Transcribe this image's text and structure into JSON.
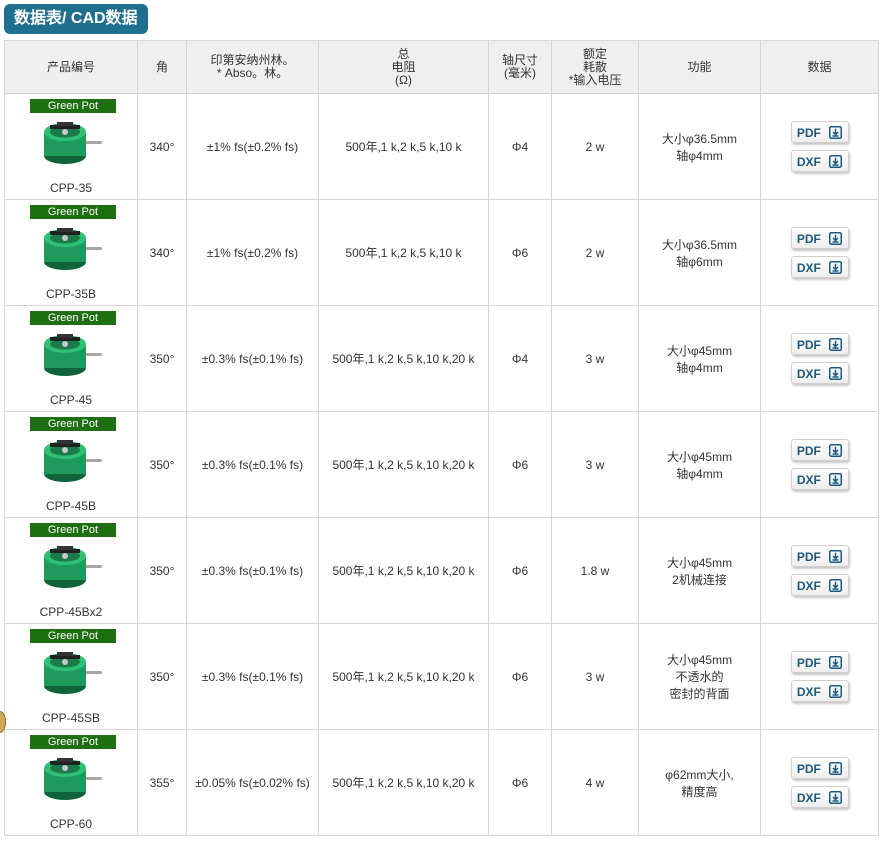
{
  "section_title": "数据表/ CAD数据",
  "headers": {
    "model": "产品编号",
    "angle": "角",
    "linearity_line1": "印第安纳州林。",
    "linearity_line2": "* Abso。林。",
    "resistance_line1": "总",
    "resistance_line2": "电阻",
    "resistance_line3": "(Ω)",
    "shaft_line1": "轴尺寸",
    "shaft_line2": "(毫米)",
    "power_line1": "额定",
    "power_line2": "耗散",
    "power_line3": "*输入电压",
    "function": "功能",
    "data": "数据"
  },
  "badge_label": "Green Pot",
  "pdf_label": "PDF",
  "dxf_label": "DXF",
  "colors": {
    "title_bg": "#1f6f8f",
    "badge_bg": "#1e6e12",
    "pot_body": "#1e9a5c",
    "button_text": "#1d5a80"
  },
  "rows": [
    {
      "model": "CPP-35",
      "angle": "340°",
      "linearity": "±1% fs(±0.2% fs)",
      "resistance": "500年,1 k,2 k,5 k,10 k",
      "shaft": "Φ4",
      "power": "2 w",
      "function_line1": "大小φ36.5mm",
      "function_line2": "轴φ4mm",
      "function_line3": ""
    },
    {
      "model": "CPP-35B",
      "angle": "340°",
      "linearity": "±1% fs(±0.2% fs)",
      "resistance": "500年,1 k,2 k,5 k,10 k",
      "shaft": "Φ6",
      "power": "2 w",
      "function_line1": "大小φ36.5mm",
      "function_line2": "轴φ6mm",
      "function_line3": ""
    },
    {
      "model": "CPP-45",
      "angle": "350°",
      "linearity": "±0.3% fs(±0.1% fs)",
      "resistance": "500年,1 k,2 k,5 k,10 k,20 k",
      "shaft": "Φ4",
      "power": "3 w",
      "function_line1": "大小φ45mm",
      "function_line2": "轴φ4mm",
      "function_line3": ""
    },
    {
      "model": "CPP-45B",
      "angle": "350°",
      "linearity": "±0.3% fs(±0.1% fs)",
      "resistance": "500年,1 k,2 k,5 k,10 k,20 k",
      "shaft": "Φ6",
      "power": "3 w",
      "function_line1": "大小φ45mm",
      "function_line2": "轴φ4mm",
      "function_line3": ""
    },
    {
      "model": "CPP-45Bx2",
      "angle": "350°",
      "linearity": "±0.3% fs(±0.1% fs)",
      "resistance": "500年,1 k,2 k,5 k,10 k,20 k",
      "shaft": "Φ6",
      "power": "1.8 w",
      "function_line1": "大小φ45mm",
      "function_line2": "2机械连接",
      "function_line3": ""
    },
    {
      "model": "CPP-45SB",
      "angle": "350°",
      "linearity": "±0.3% fs(±0.1% fs)",
      "resistance": "500年,1 k,2 k,5 k,10 k,20 k",
      "shaft": "Φ6",
      "power": "3 w",
      "function_line1": "大小φ45mm",
      "function_line2": "不透水的",
      "function_line3": "密封的背面"
    },
    {
      "model": "CPP-60",
      "angle": "355°",
      "linearity": "±0.05% fs(±0.02% fs)",
      "resistance": "500年,1 k,2 k,5 k,10 k,20 k",
      "shaft": "Φ6",
      "power": "4 w",
      "function_line1": "φ62mm大小,",
      "function_line2": "精度高",
      "function_line3": ""
    }
  ]
}
